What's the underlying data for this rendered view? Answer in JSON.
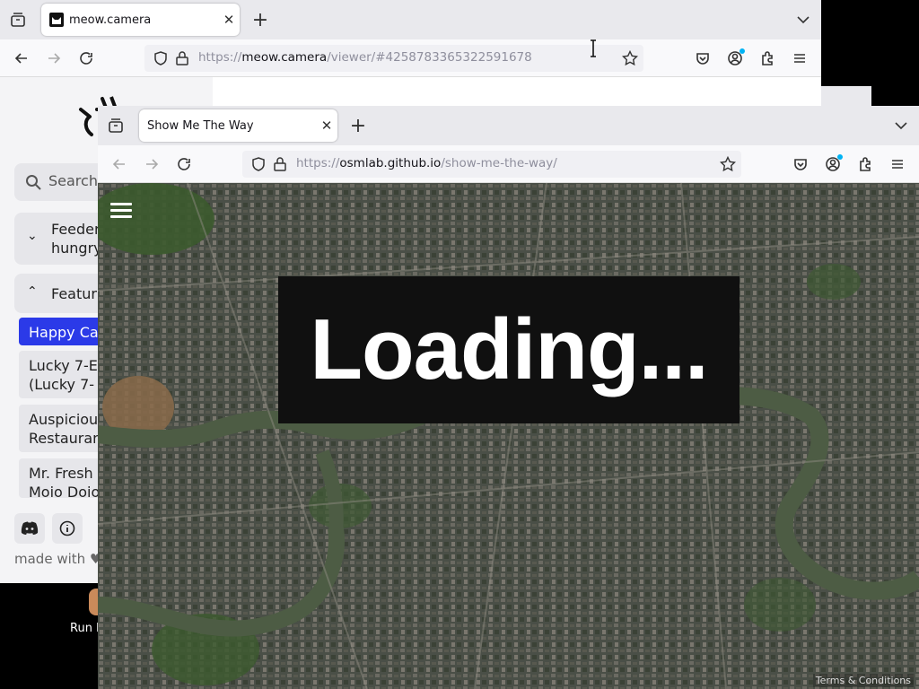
{
  "back_window": {
    "tab_title": "meow.camera",
    "url_prefix": "https://",
    "url_host": "meow.camera",
    "url_path": "/viewer/#4258783365322591678",
    "search_placeholder": "Search",
    "feeders_label_line1": "Feeder",
    "feeders_label_line2": "hungry",
    "featured_label": "Featur",
    "list_items": [
      {
        "line1": "Happy Ca",
        "line2": ""
      },
      {
        "line1": "Lucky 7-E",
        "line2": "(Lucky 7-"
      },
      {
        "line1": "Auspiciou",
        "line2": "Restauran"
      },
      {
        "line1": "Mr. Fresh (",
        "line2": "Moio Doio"
      }
    ],
    "made_with": "made with ♥",
    "run_label": "Run F"
  },
  "front_window": {
    "tab_title": "Show Me The Way",
    "url_prefix": "https://",
    "url_host": "osmlab.github.io",
    "url_path": "/show-me-the-way/",
    "loading_text": "Loading...",
    "terms_text": "Terms & Conditions"
  },
  "colors": {
    "active_item": "#2b3ae8",
    "river": "#4d5c44",
    "map_base": "#3f4a3c"
  }
}
